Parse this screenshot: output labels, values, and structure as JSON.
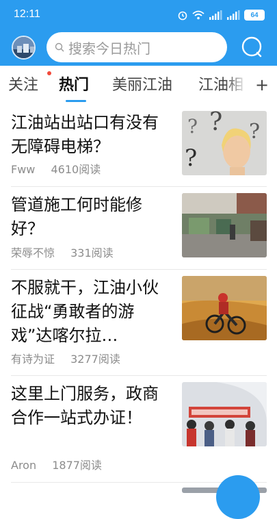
{
  "status": {
    "time": "12:11",
    "battery": "64"
  },
  "header": {
    "search_placeholder": "搜索今日热门",
    "accent_color": "#2b9cef"
  },
  "tabs": [
    {
      "label": "关注",
      "has_dot": true
    },
    {
      "label": "热门",
      "active": true
    },
    {
      "label": "美丽江油"
    },
    {
      "label": "江油相"
    }
  ],
  "tab_more_label": "+",
  "feed": [
    {
      "title": "江油站出站口有没有无障碍电梯？",
      "author": "Fww",
      "reads": "4610阅读",
      "thumb_icon": "question-portrait-image"
    },
    {
      "title": "管道施工何时能修好？",
      "author": "荣辱不惊",
      "reads": "331阅读",
      "thumb_icon": "street-construction-image"
    },
    {
      "title": "不服就干，江油小伙征战“勇敢者的游戏”达喀尔拉…",
      "author": "有诗为证",
      "reads": "3277阅读",
      "thumb_icon": "desert-motorbike-image"
    },
    {
      "title": "这里上门服务，政商合作一站式办证！",
      "author": "Aron",
      "reads": "1877阅读",
      "thumb_icon": "service-crowd-image"
    }
  ]
}
